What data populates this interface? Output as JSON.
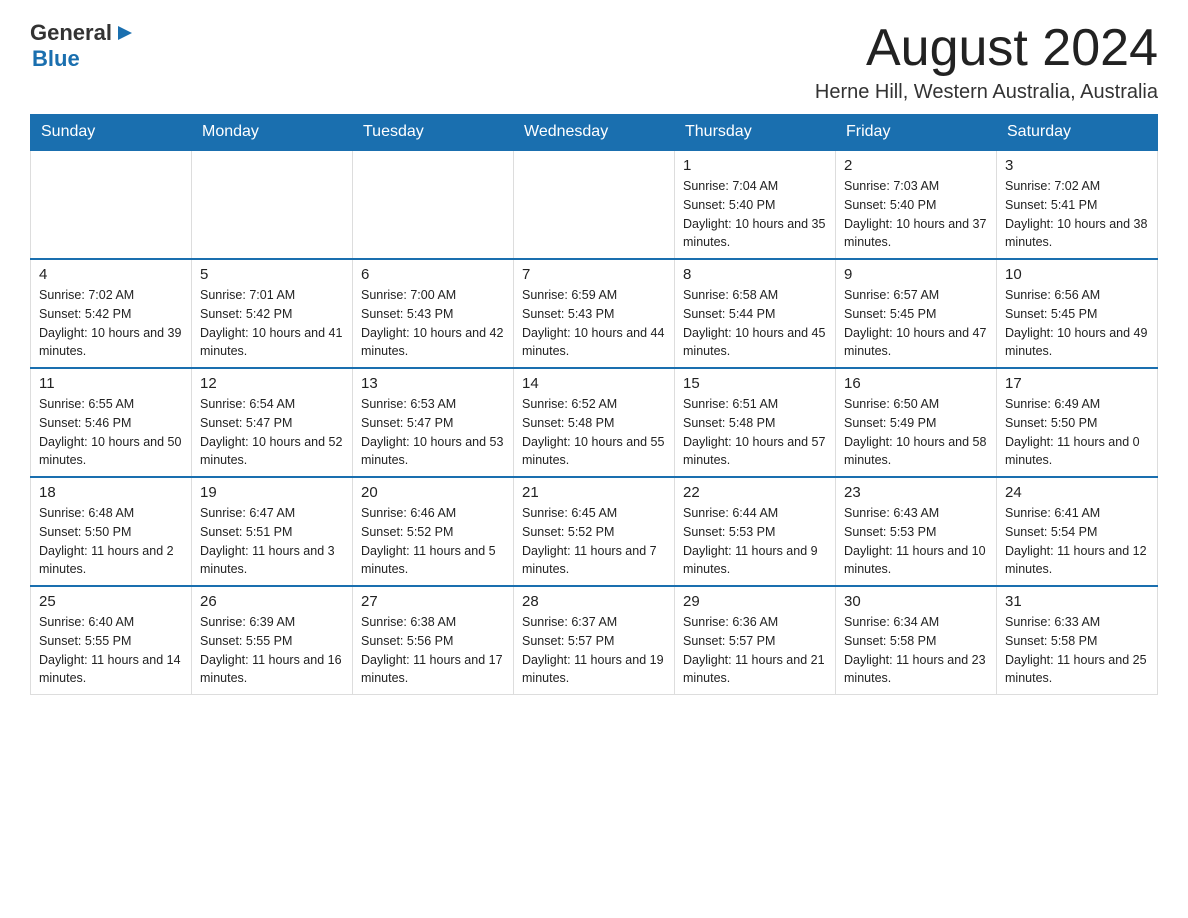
{
  "header": {
    "logo_general": "General",
    "logo_arrow": "▶",
    "logo_blue": "Blue",
    "month_title": "August 2024",
    "location": "Herne Hill, Western Australia, Australia"
  },
  "weekdays": [
    "Sunday",
    "Monday",
    "Tuesday",
    "Wednesday",
    "Thursday",
    "Friday",
    "Saturday"
  ],
  "weeks": [
    [
      {
        "day": "",
        "info": ""
      },
      {
        "day": "",
        "info": ""
      },
      {
        "day": "",
        "info": ""
      },
      {
        "day": "",
        "info": ""
      },
      {
        "day": "1",
        "info": "Sunrise: 7:04 AM\nSunset: 5:40 PM\nDaylight: 10 hours and 35 minutes."
      },
      {
        "day": "2",
        "info": "Sunrise: 7:03 AM\nSunset: 5:40 PM\nDaylight: 10 hours and 37 minutes."
      },
      {
        "day": "3",
        "info": "Sunrise: 7:02 AM\nSunset: 5:41 PM\nDaylight: 10 hours and 38 minutes."
      }
    ],
    [
      {
        "day": "4",
        "info": "Sunrise: 7:02 AM\nSunset: 5:42 PM\nDaylight: 10 hours and 39 minutes."
      },
      {
        "day": "5",
        "info": "Sunrise: 7:01 AM\nSunset: 5:42 PM\nDaylight: 10 hours and 41 minutes."
      },
      {
        "day": "6",
        "info": "Sunrise: 7:00 AM\nSunset: 5:43 PM\nDaylight: 10 hours and 42 minutes."
      },
      {
        "day": "7",
        "info": "Sunrise: 6:59 AM\nSunset: 5:43 PM\nDaylight: 10 hours and 44 minutes."
      },
      {
        "day": "8",
        "info": "Sunrise: 6:58 AM\nSunset: 5:44 PM\nDaylight: 10 hours and 45 minutes."
      },
      {
        "day": "9",
        "info": "Sunrise: 6:57 AM\nSunset: 5:45 PM\nDaylight: 10 hours and 47 minutes."
      },
      {
        "day": "10",
        "info": "Sunrise: 6:56 AM\nSunset: 5:45 PM\nDaylight: 10 hours and 49 minutes."
      }
    ],
    [
      {
        "day": "11",
        "info": "Sunrise: 6:55 AM\nSunset: 5:46 PM\nDaylight: 10 hours and 50 minutes."
      },
      {
        "day": "12",
        "info": "Sunrise: 6:54 AM\nSunset: 5:47 PM\nDaylight: 10 hours and 52 minutes."
      },
      {
        "day": "13",
        "info": "Sunrise: 6:53 AM\nSunset: 5:47 PM\nDaylight: 10 hours and 53 minutes."
      },
      {
        "day": "14",
        "info": "Sunrise: 6:52 AM\nSunset: 5:48 PM\nDaylight: 10 hours and 55 minutes."
      },
      {
        "day": "15",
        "info": "Sunrise: 6:51 AM\nSunset: 5:48 PM\nDaylight: 10 hours and 57 minutes."
      },
      {
        "day": "16",
        "info": "Sunrise: 6:50 AM\nSunset: 5:49 PM\nDaylight: 10 hours and 58 minutes."
      },
      {
        "day": "17",
        "info": "Sunrise: 6:49 AM\nSunset: 5:50 PM\nDaylight: 11 hours and 0 minutes."
      }
    ],
    [
      {
        "day": "18",
        "info": "Sunrise: 6:48 AM\nSunset: 5:50 PM\nDaylight: 11 hours and 2 minutes."
      },
      {
        "day": "19",
        "info": "Sunrise: 6:47 AM\nSunset: 5:51 PM\nDaylight: 11 hours and 3 minutes."
      },
      {
        "day": "20",
        "info": "Sunrise: 6:46 AM\nSunset: 5:52 PM\nDaylight: 11 hours and 5 minutes."
      },
      {
        "day": "21",
        "info": "Sunrise: 6:45 AM\nSunset: 5:52 PM\nDaylight: 11 hours and 7 minutes."
      },
      {
        "day": "22",
        "info": "Sunrise: 6:44 AM\nSunset: 5:53 PM\nDaylight: 11 hours and 9 minutes."
      },
      {
        "day": "23",
        "info": "Sunrise: 6:43 AM\nSunset: 5:53 PM\nDaylight: 11 hours and 10 minutes."
      },
      {
        "day": "24",
        "info": "Sunrise: 6:41 AM\nSunset: 5:54 PM\nDaylight: 11 hours and 12 minutes."
      }
    ],
    [
      {
        "day": "25",
        "info": "Sunrise: 6:40 AM\nSunset: 5:55 PM\nDaylight: 11 hours and 14 minutes."
      },
      {
        "day": "26",
        "info": "Sunrise: 6:39 AM\nSunset: 5:55 PM\nDaylight: 11 hours and 16 minutes."
      },
      {
        "day": "27",
        "info": "Sunrise: 6:38 AM\nSunset: 5:56 PM\nDaylight: 11 hours and 17 minutes."
      },
      {
        "day": "28",
        "info": "Sunrise: 6:37 AM\nSunset: 5:57 PM\nDaylight: 11 hours and 19 minutes."
      },
      {
        "day": "29",
        "info": "Sunrise: 6:36 AM\nSunset: 5:57 PM\nDaylight: 11 hours and 21 minutes."
      },
      {
        "day": "30",
        "info": "Sunrise: 6:34 AM\nSunset: 5:58 PM\nDaylight: 11 hours and 23 minutes."
      },
      {
        "day": "31",
        "info": "Sunrise: 6:33 AM\nSunset: 5:58 PM\nDaylight: 11 hours and 25 minutes."
      }
    ]
  ]
}
